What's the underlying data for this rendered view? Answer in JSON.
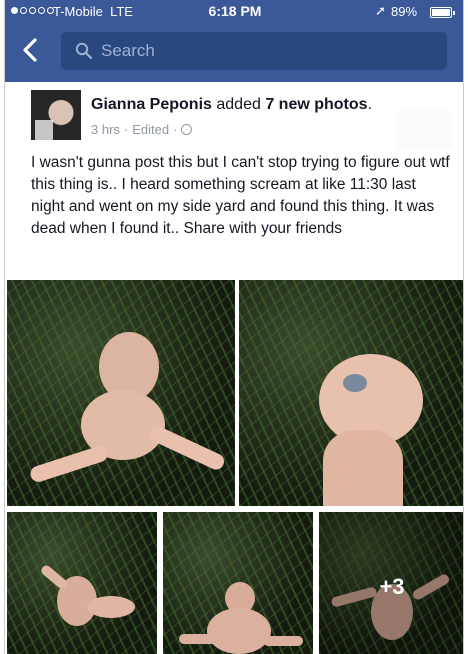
{
  "status_bar": {
    "carrier": "T-Mobile",
    "network": "LTE",
    "time": "6:18 PM",
    "battery": "89%"
  },
  "nav": {
    "search_placeholder": "Search"
  },
  "post": {
    "author": "Gianna Peponis",
    "action": "added",
    "photo_count": "7 new photos",
    "timestamp": "3 hrs",
    "edited": "Edited",
    "text": "I wasn't gunna post this but I can't stop trying to figure out wtf this thing is.. I heard something scream at like 11:30 last night and went on my side yard and found this thing. It was dead when I found it.. Share with your friends",
    "more_photos_label": "+3"
  },
  "colors": {
    "brand": "#3b5998",
    "search_bg": "#29487d",
    "text": "#141823",
    "meta": "#9197a3"
  },
  "icons": [
    "back-arrow-icon",
    "search-icon",
    "location-arrow-icon",
    "battery-icon",
    "globe-icon"
  ]
}
